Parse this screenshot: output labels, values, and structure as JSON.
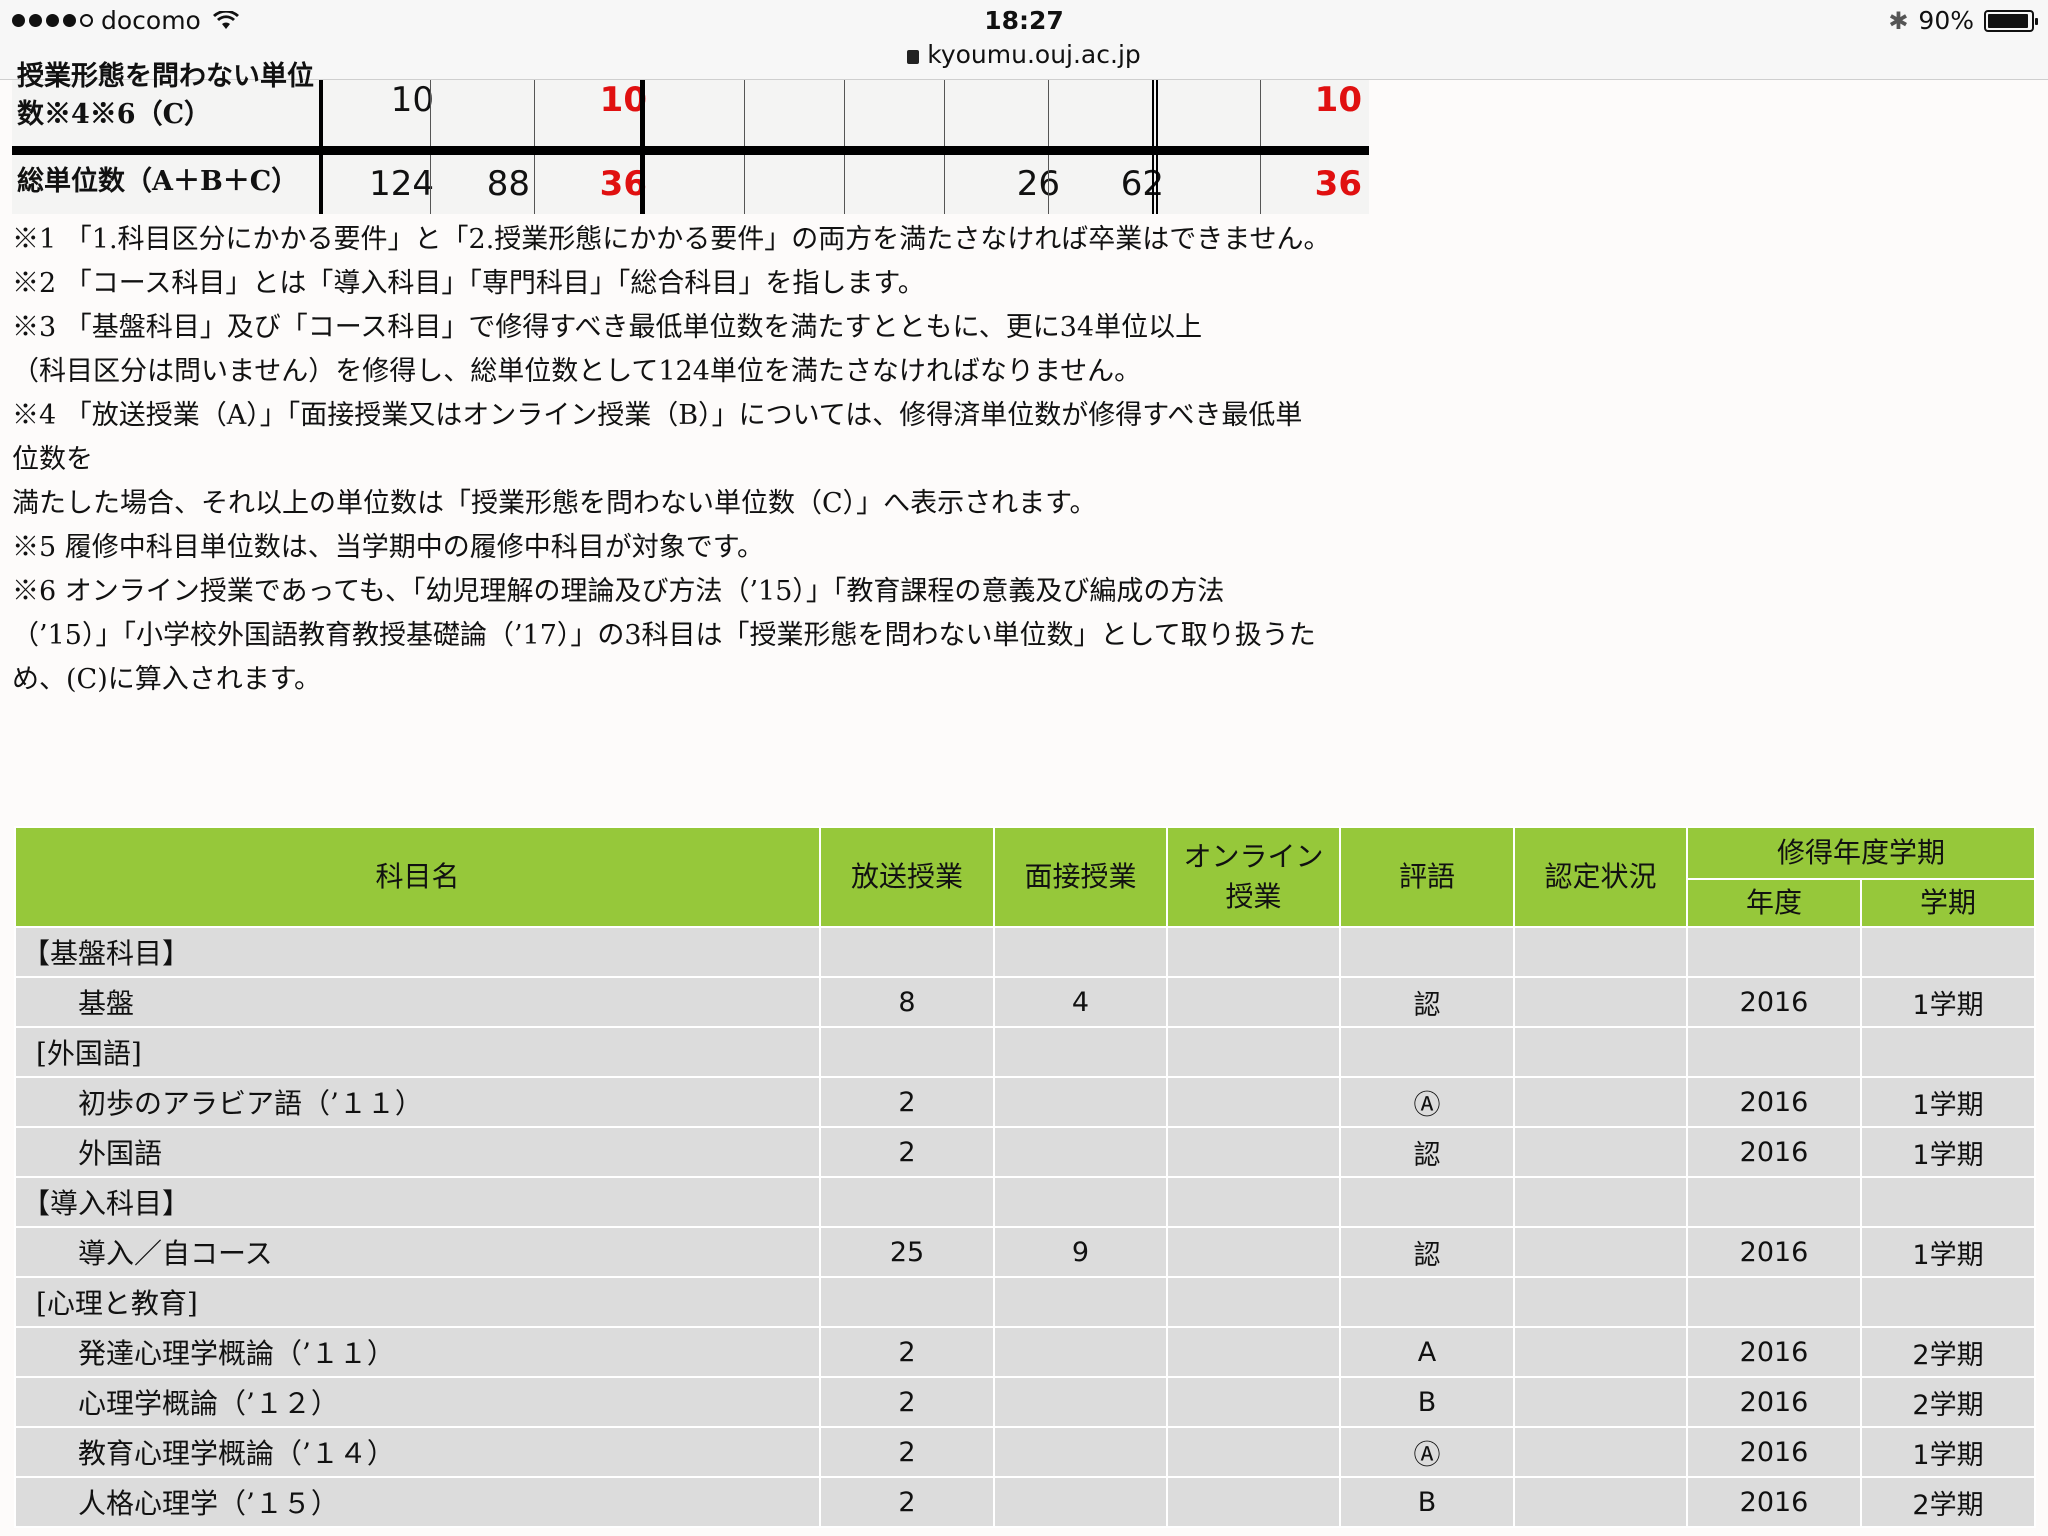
{
  "status_bar": {
    "carrier": "docomo",
    "time": "18:27",
    "url": "kyoumu.ouj.ac.jp",
    "battery": "90%"
  },
  "top_table": {
    "row_c": {
      "label_line1": "授業形態を問わない単位",
      "label_line2": "数※4※6（C）",
      "v1": "10",
      "v3": "10",
      "v_last": "10"
    },
    "row_total": {
      "label": "総単位数（A＋B＋C）",
      "v1": "124",
      "v2": "88",
      "v3": "36",
      "v7": "26",
      "v8": "62",
      "v_last": "36"
    }
  },
  "notes": [
    "※1 「1.科目区分にかかる要件」と「2.授業形態にかかる要件」の両方を満たさなければ卒業はできません。",
    "※2 「コース科目」とは「導入科目」「専門科目」「総合科目」を指します。",
    "※3 「基盤科目」及び「コース科目」で修得すべき最低単位数を満たすとともに、更に34単位以上",
    "（科目区分は問いません）を修得し、総単位数として124単位を満たさなければなりません。",
    "※4 「放送授業（A）」「面接授業又はオンライン授業（B）」については、修得済単位数が修得すべき最低単",
    "位数を",
    "満たした場合、それ以上の単位数は「授業形態を問わない単位数（C）」へ表示されます。",
    "※5 履修中科目単位数は、当学期中の履修中科目が対象です。",
    "※6 オンライン授業であっても、「幼児理解の理論及び方法（’15）」「教育課程の意義及び編成の方法",
    "（’15）」「小学校外国語教育教授基礎論（’17）」の3科目は「授業形態を問わない単位数」として取り扱うた",
    "め、(C)に算入されます。"
  ],
  "grades_table": {
    "headers": {
      "subject": "科目名",
      "broadcast": "放送授業",
      "interview": "面接授業",
      "online_line1": "オンライン",
      "online_line2": "授業",
      "grade": "評語",
      "cert": "認定状況",
      "term_group": "修得年度学期",
      "year": "年度",
      "term": "学期"
    },
    "rows": [
      {
        "type": "cat",
        "name": "【基盤科目】",
        "broadcast": "",
        "interview": "",
        "online": "",
        "grade": "",
        "cert": "",
        "year": "",
        "term": ""
      },
      {
        "type": "item",
        "name": "基盤",
        "broadcast": "8",
        "interview": "4",
        "online": "",
        "grade": "認",
        "cert": "",
        "year": "2016",
        "term": "1学期"
      },
      {
        "type": "sub",
        "name": "[外国語]",
        "broadcast": "",
        "interview": "",
        "online": "",
        "grade": "",
        "cert": "",
        "year": "",
        "term": ""
      },
      {
        "type": "item",
        "name": "初歩のアラビア語（’１１）",
        "broadcast": "2",
        "interview": "",
        "online": "",
        "grade": "Ⓐ",
        "cert": "",
        "year": "2016",
        "term": "1学期"
      },
      {
        "type": "item",
        "name": "外国語",
        "broadcast": "2",
        "interview": "",
        "online": "",
        "grade": "認",
        "cert": "",
        "year": "2016",
        "term": "1学期"
      },
      {
        "type": "cat",
        "name": "【導入科目】",
        "broadcast": "",
        "interview": "",
        "online": "",
        "grade": "",
        "cert": "",
        "year": "",
        "term": ""
      },
      {
        "type": "item",
        "name": "導入／自コース",
        "broadcast": "25",
        "interview": "9",
        "online": "",
        "grade": "認",
        "cert": "",
        "year": "2016",
        "term": "1学期"
      },
      {
        "type": "sub",
        "name": "[心理と教育]",
        "broadcast": "",
        "interview": "",
        "online": "",
        "grade": "",
        "cert": "",
        "year": "",
        "term": ""
      },
      {
        "type": "item",
        "name": "発達心理学概論（’１１）",
        "broadcast": "2",
        "interview": "",
        "online": "",
        "grade": "A",
        "cert": "",
        "year": "2016",
        "term": "2学期"
      },
      {
        "type": "item",
        "name": "心理学概論（’１２）",
        "broadcast": "2",
        "interview": "",
        "online": "",
        "grade": "B",
        "cert": "",
        "year": "2016",
        "term": "2学期"
      },
      {
        "type": "item",
        "name": "教育心理学概論（’１４）",
        "broadcast": "2",
        "interview": "",
        "online": "",
        "grade": "Ⓐ",
        "cert": "",
        "year": "2016",
        "term": "1学期"
      },
      {
        "type": "item",
        "name": "人格心理学（’１５）",
        "broadcast": "2",
        "interview": "",
        "online": "",
        "grade": "B",
        "cert": "",
        "year": "2016",
        "term": "2学期"
      }
    ]
  }
}
